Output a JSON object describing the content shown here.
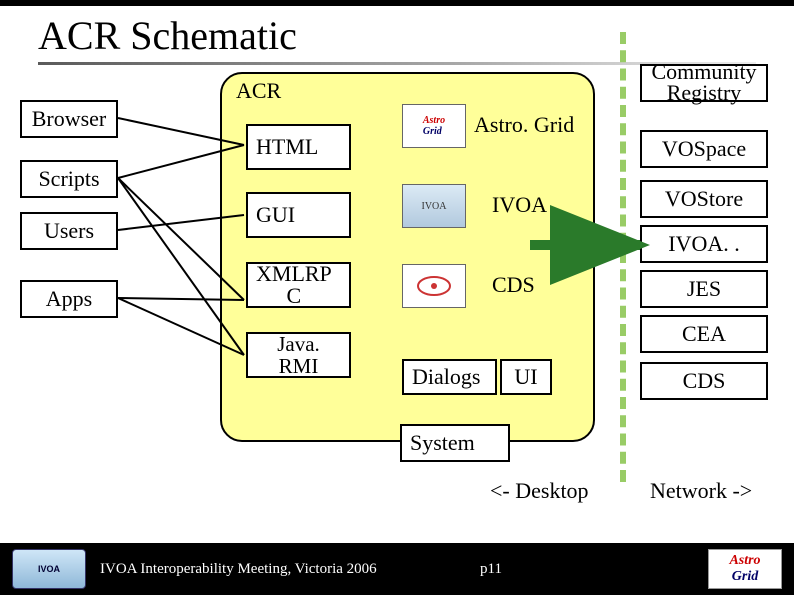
{
  "title": "ACR Schematic",
  "acr": {
    "label": "ACR"
  },
  "clients": {
    "browser": "Browser",
    "scripts": "Scripts",
    "users": "Users",
    "apps": "Apps"
  },
  "protocols": {
    "html": "HTML",
    "gui": "GUI",
    "xmlrpc": "XMLRP\nC",
    "javarmi": "Java. RMI"
  },
  "services_internal": {
    "astrogrid": "Astro. Grid",
    "ivoa": "IVOA",
    "cds": "CDS"
  },
  "ui": {
    "dialogs": "Dialogs",
    "ui": "UI",
    "system": "System"
  },
  "network": {
    "community_registry": "Community\nRegistry",
    "vospace": "VOSpace",
    "vostore": "VOStore",
    "ivoa": "IVOA. .",
    "jes": "JES",
    "cea": "CEA",
    "cds": "CDS"
  },
  "region": {
    "desktop": "<- Desktop",
    "network": "Network ->"
  },
  "footer": {
    "venue": "IVOA Interoperability Meeting, Victoria 2006",
    "page": "p11",
    "left_icon": "IVOA",
    "right_icon_astro": "Astro",
    "right_icon_grid": "Grid"
  }
}
